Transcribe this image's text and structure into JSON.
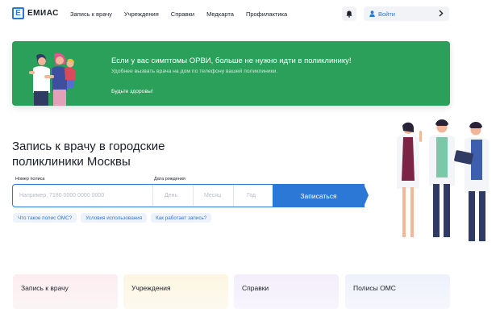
{
  "brand": {
    "logo_letter": "Е",
    "name": "ЕМИАС",
    "color": "#2b78d6"
  },
  "nav": [
    {
      "label": "Запись к врачу"
    },
    {
      "label": "Учреждения"
    },
    {
      "label": "Справки"
    },
    {
      "label": "Медкарта"
    },
    {
      "label": "Профилактика"
    }
  ],
  "header": {
    "login_label": "Войти",
    "bell_icon": "bell-icon",
    "user_icon": "user-icon"
  },
  "banner": {
    "title": "Если у вас симптомы ОРВИ, больше не нужно идти в поликлинику!",
    "subtitle": "Удобнее вызвать врача на дом по телефону вашей поликлиники.",
    "cta": "Будьте здоровы!",
    "color": "#2aa05a"
  },
  "hero": {
    "title": "Запись к врачу в городские поликлиники Москвы"
  },
  "form": {
    "policy_label": "Номер полиса",
    "dob_label": "Дата рождения",
    "policy_placeholder": "Например, 7180 0000 0000 0000",
    "day_placeholder": "День",
    "month_placeholder": "Месяц",
    "year_placeholder": "Год",
    "submit_label": "Записаться"
  },
  "links": [
    {
      "label": "Что такое полис ОМС?"
    },
    {
      "label": "Условия использования"
    },
    {
      "label": "Как работает запись?"
    }
  ],
  "cards": [
    {
      "label": "Запись к врачу"
    },
    {
      "label": "Учреждения"
    },
    {
      "label": "Справки"
    },
    {
      "label": "Полисы ОМС"
    }
  ]
}
